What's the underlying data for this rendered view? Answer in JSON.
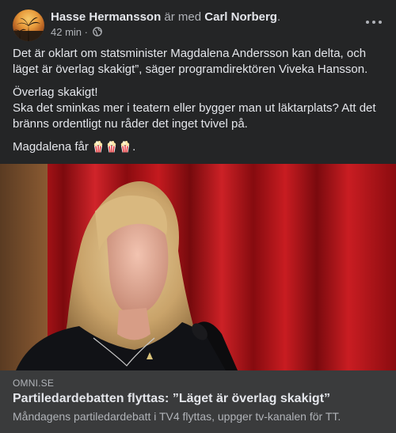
{
  "post": {
    "author": "Hasse Hermansson",
    "with_text": "är med",
    "tagged": "Carl Norberg",
    "tagged_suffix": ".",
    "time": "42 min",
    "time_sep": " · ",
    "audience_icon": "globe-icon",
    "more_icon": "more-dots-icon"
  },
  "text": {
    "p1": "Det är oklart om statsminister Magdalena Andersson kan delta, och läget är överlag skakigt”, säger programdirektören Viveka Hansson.",
    "p2_line1": "Överlag skakigt!",
    "p2_line2": "Ska det sminkas mer i teatern eller bygger man ut läktarplats? Att det bränns ordentligt nu råder det inget tvivel på.",
    "p3_prefix": "Magdalena får",
    "p3_emoji": "popcorn-icon",
    "p3_suffix": "."
  },
  "link": {
    "domain": "OMNI.SE",
    "title": "Partiledardebatten flyttas: ”Läget är överlag skakigt”",
    "description": "Måndagens partiledardebatt i TV4 flyttas, uppger tv-kanalen för TT."
  },
  "colors": {
    "background": "#242526",
    "link_box": "#3a3b3c",
    "text_primary": "#e4e6eb",
    "text_secondary": "#b0b3b8",
    "curtain": "#b01318"
  }
}
